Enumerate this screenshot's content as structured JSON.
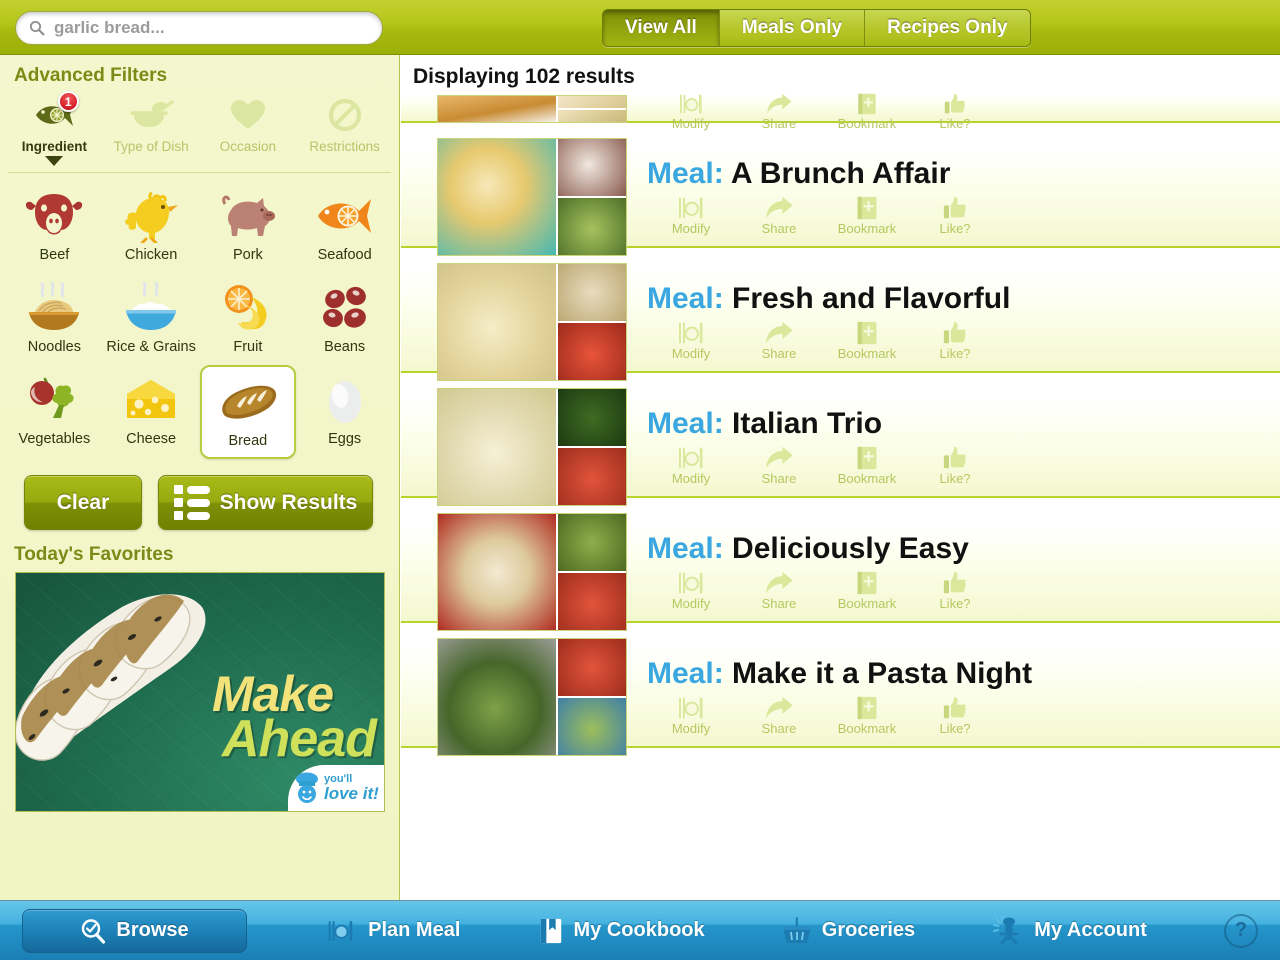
{
  "search": {
    "value": "garlic bread...",
    "placeholder": "garlic bread...",
    "icon": "search-icon"
  },
  "view_toggle": {
    "options": [
      {
        "label": "View All",
        "active": true
      },
      {
        "label": "Meals Only",
        "active": false
      },
      {
        "label": "Recipes Only",
        "active": false
      }
    ]
  },
  "sidebar": {
    "title": "Advanced Filters",
    "filter_tabs": [
      {
        "label": "Ingredient",
        "icon": "fish-icon",
        "active": true,
        "badge": "1"
      },
      {
        "label": "Type of Dish",
        "icon": "bowl-spoon-icon",
        "active": false
      },
      {
        "label": "Occasion",
        "icon": "heart-icon",
        "active": false
      },
      {
        "label": "Restrictions",
        "icon": "no-entry-icon",
        "active": false
      }
    ],
    "ingredients": [
      {
        "label": "Beef",
        "icon": "cow-icon",
        "selected": false
      },
      {
        "label": "Chicken",
        "icon": "rooster-icon",
        "selected": false
      },
      {
        "label": "Pork",
        "icon": "pig-icon",
        "selected": false
      },
      {
        "label": "Seafood",
        "icon": "fish-icon",
        "selected": false
      },
      {
        "label": "Noodles",
        "icon": "noodles-icon",
        "selected": false
      },
      {
        "label": "Rice & Grains",
        "icon": "rice-bowl-icon",
        "selected": false
      },
      {
        "label": "Fruit",
        "icon": "fruit-icon",
        "selected": false
      },
      {
        "label": "Beans",
        "icon": "beans-icon",
        "selected": false
      },
      {
        "label": "Vegetables",
        "icon": "vegetables-icon",
        "selected": false
      },
      {
        "label": "Cheese",
        "icon": "cheese-icon",
        "selected": false
      },
      {
        "label": "Bread",
        "icon": "bread-loaf-icon",
        "selected": true
      },
      {
        "label": "Eggs",
        "icon": "egg-icon",
        "selected": false
      }
    ],
    "clear_label": "Clear",
    "show_results_label": "Show Results",
    "favorites_title": "Today's Favorites",
    "promo": {
      "word1": "Make",
      "word2": "Ahead",
      "logo_line1": "you'll",
      "logo_line2": "love it!"
    }
  },
  "results": {
    "header": "Displaying 102 results",
    "actions": [
      {
        "label": "Modify",
        "icon": "utensils-plate-icon"
      },
      {
        "label": "Share",
        "icon": "share-arrow-icon"
      },
      {
        "label": "Bookmark",
        "icon": "book-plus-icon"
      },
      {
        "label": "Like?",
        "icon": "thumbs-up-icon"
      }
    ],
    "items": [
      {
        "kind": "",
        "title": "",
        "partial": true
      },
      {
        "kind": "Meal:",
        "title": "A Brunch Affair",
        "partial": false
      },
      {
        "kind": "Meal:",
        "title": "Fresh and Flavorful",
        "partial": false
      },
      {
        "kind": "Meal:",
        "title": "Italian Trio",
        "partial": false
      },
      {
        "kind": "Meal:",
        "title": "Deliciously Easy",
        "partial": false
      },
      {
        "kind": "Meal:",
        "title": "Make it a Pasta Night",
        "partial": false
      }
    ]
  },
  "navbar": {
    "items": [
      {
        "label": "Browse",
        "icon": "browse-magnifier-icon",
        "active": true
      },
      {
        "label": "Plan Meal",
        "icon": "utensils-plate-icon",
        "active": false
      },
      {
        "label": "My Cookbook",
        "icon": "cookbook-icon",
        "active": false
      },
      {
        "label": "Groceries",
        "icon": "basket-icon",
        "active": false
      },
      {
        "label": "My Account",
        "icon": "chef-person-icon",
        "active": false
      }
    ],
    "help_label": "?"
  },
  "colors": {
    "brand_green": "#a9bb10",
    "accent_blue": "#3aa7e0",
    "nav_blue": "#2596cb",
    "badge_red": "#d8212a",
    "row_border": "#b8d42a"
  }
}
